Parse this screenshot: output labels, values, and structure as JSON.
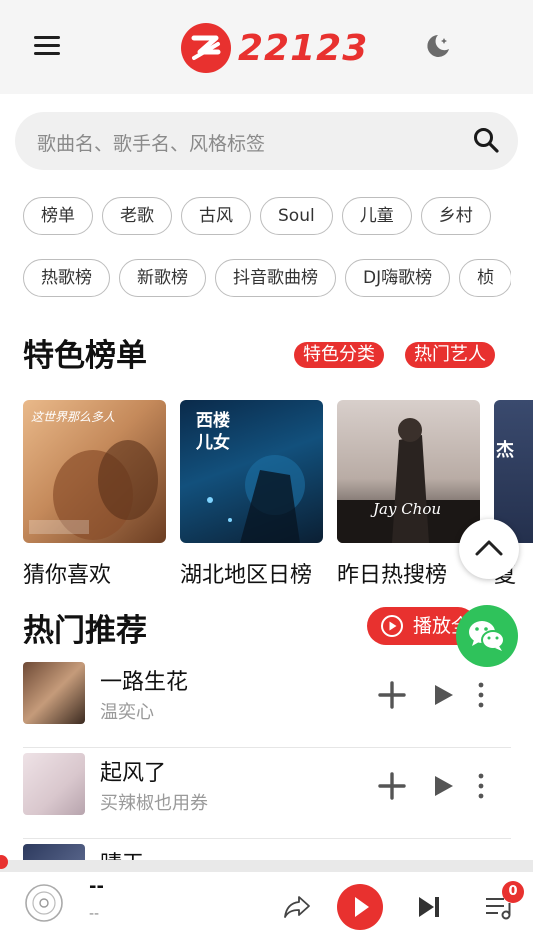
{
  "header": {
    "logo_text": "22123",
    "menu_icon": "menu-icon",
    "theme_icon": "moon-icon"
  },
  "search": {
    "placeholder": "歌曲名、歌手名、风格标签",
    "icon": "search-icon"
  },
  "tags_row1": [
    "榜单",
    "老歌",
    "古风",
    "Soul",
    "儿童",
    "乡村"
  ],
  "tags_row2": [
    "热歌榜",
    "新歌榜",
    "抖音歌曲榜",
    "DJ嗨歌榜",
    "桢"
  ],
  "featured": {
    "title": "特色榜单",
    "link_category": "特色分类",
    "link_artists": "热门艺人",
    "cards": [
      {
        "label": "猜你喜欢",
        "cover_text": "这世界那么多人"
      },
      {
        "label": "湖北地区日榜",
        "cover_text": "西楼儿女"
      },
      {
        "label": "昨日热搜榜",
        "cover_text": "Jay Chou"
      },
      {
        "label": "夏",
        "cover_text": "杰"
      }
    ]
  },
  "hot": {
    "title": "热门推荐",
    "play_all": "播放全部",
    "songs": [
      {
        "title": "一路生花",
        "artist": "温奕心"
      },
      {
        "title": "起风了",
        "artist": "买辣椒也用券"
      },
      {
        "title": "晴天",
        "artist": ""
      }
    ]
  },
  "player": {
    "title": "--",
    "artist": "--",
    "queue_count": "0"
  },
  "colors": {
    "accent": "#e8312f",
    "wechat": "#2fc25b",
    "header_bg": "#f5f5f5"
  }
}
